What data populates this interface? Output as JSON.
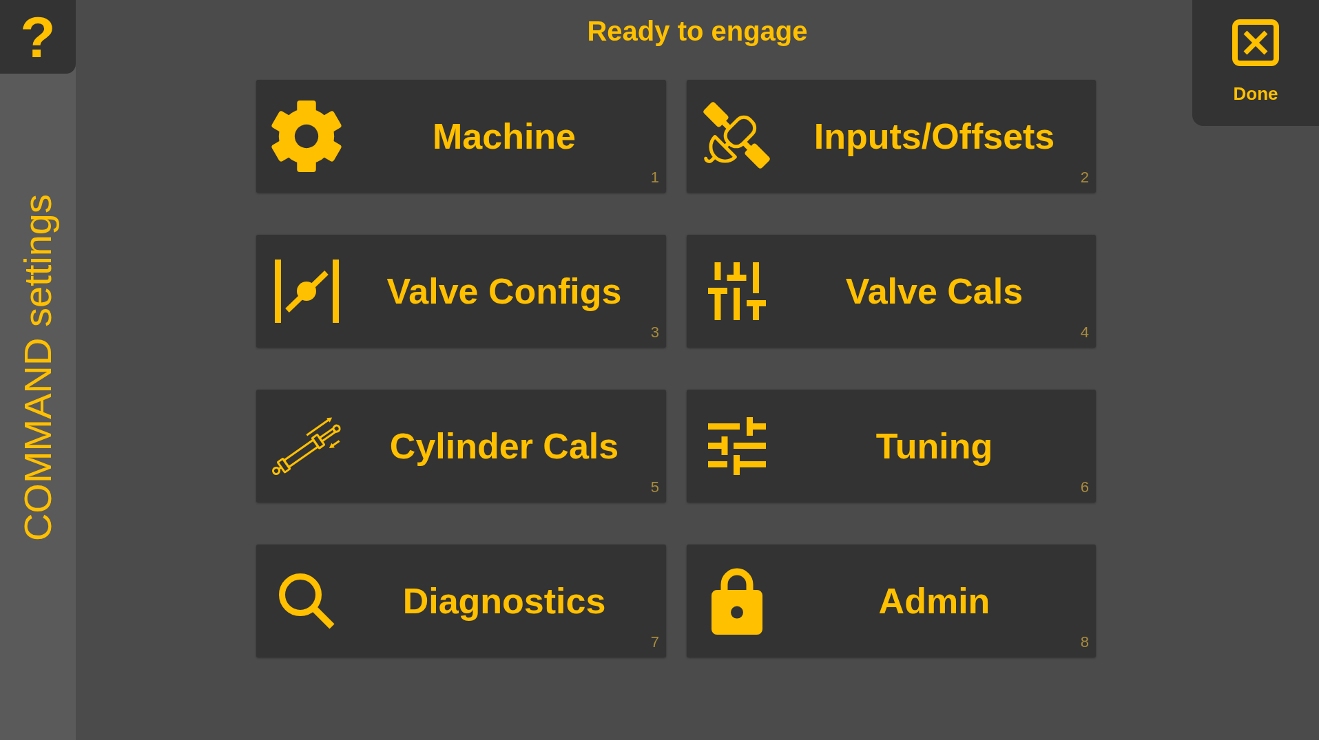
{
  "help_button": {
    "label": "?"
  },
  "sidebar": {
    "title": "COMMAND settings"
  },
  "header": {
    "title": "Ready to engage"
  },
  "done_button": {
    "label": "Done"
  },
  "menu": [
    {
      "label": "Machine",
      "shortcut": "1"
    },
    {
      "label": "Inputs/Offsets",
      "shortcut": "2"
    },
    {
      "label": "Valve Configs",
      "shortcut": "3"
    },
    {
      "label": "Valve Cals",
      "shortcut": "4"
    },
    {
      "label": "Cylinder Cals",
      "shortcut": "5"
    },
    {
      "label": "Tuning",
      "shortcut": "6"
    },
    {
      "label": "Diagnostics",
      "shortcut": "7"
    },
    {
      "label": "Admin",
      "shortcut": "8"
    }
  ]
}
